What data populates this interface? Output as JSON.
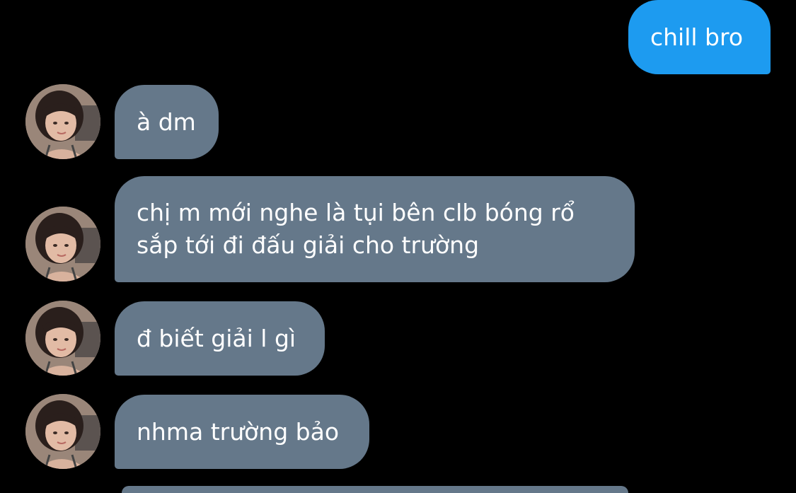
{
  "conversation": {
    "messages": [
      {
        "direction": "outgoing",
        "text": "chill bro"
      },
      {
        "direction": "incoming",
        "text": "à dm"
      },
      {
        "direction": "incoming",
        "text": "chị m mới nghe là tụi bên clb bóng rổ\nsắp tới đi đấu giải cho trường"
      },
      {
        "direction": "incoming",
        "text": "đ biết giải l gì"
      },
      {
        "direction": "incoming",
        "text": "nhma trường bảo"
      }
    ]
  },
  "colors": {
    "background": "#000000",
    "outgoing_bubble": "#1d9bf0",
    "incoming_bubble": "#65788a",
    "text": "#ffffff"
  }
}
